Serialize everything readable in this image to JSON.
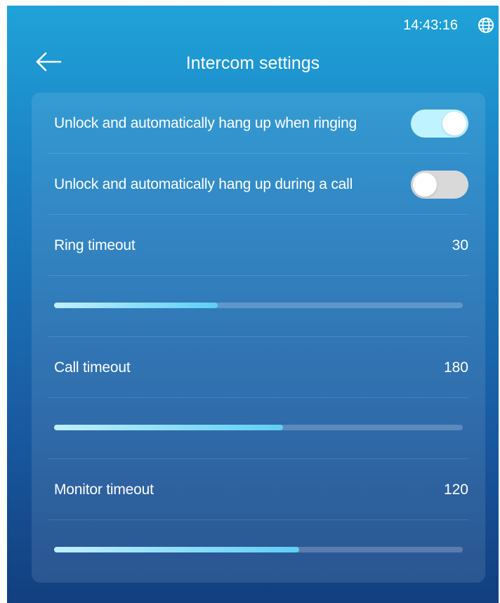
{
  "status_bar": {
    "time": "14:43:16",
    "icon": "globe-icon"
  },
  "header": {
    "back_icon": "arrow-left-icon",
    "title": "Intercom settings"
  },
  "settings": {
    "unlock_hangup_ringing": {
      "label": "Unlock and automatically hang up when ringing",
      "enabled": true
    },
    "unlock_hangup_call": {
      "label": "Unlock and automatically hang up during a call",
      "enabled": false
    },
    "ring_timeout": {
      "label": "Ring timeout",
      "value": "30",
      "slider_fraction": 0.4
    },
    "call_timeout": {
      "label": "Call timeout",
      "value": "180",
      "slider_fraction": 0.56
    },
    "monitor_timeout": {
      "label": "Monitor timeout",
      "value": "120",
      "slider_fraction": 0.6
    }
  },
  "colors": {
    "toggle_on": "#bff3ff",
    "toggle_off": "#d9d9d9",
    "slider_fill_start": "#bfefff",
    "slider_fill_end": "#5ecff5"
  }
}
